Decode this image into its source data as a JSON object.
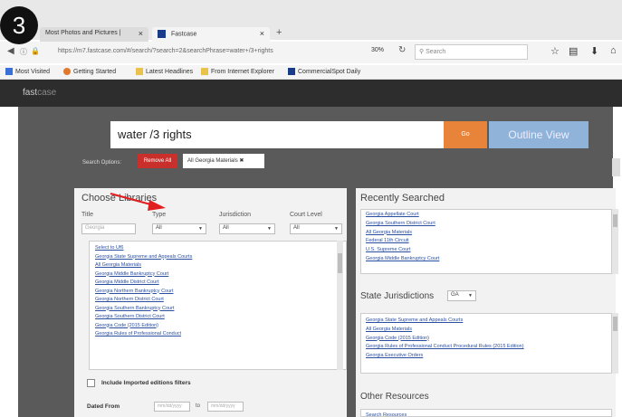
{
  "step": "3",
  "browser": {
    "tabs": [
      {
        "label": "Most Photos and Pictures |",
        "active": false
      },
      {
        "label": "Fastcase",
        "active": true
      }
    ],
    "url": "https://m7.fastcase.com/#/search/?search=2&searchPhrase=water+/3+rights",
    "zoom": "30%",
    "search_placeholder": "Search",
    "bookmarks": [
      "Most Visited",
      "Getting Started",
      "Latest Headlines",
      "From Internet Explorer",
      "CommercialSpot Daily"
    ]
  },
  "app": {
    "logo_main": "fast",
    "logo_sub": "case",
    "query": "water /3 rights",
    "go_label": "Go",
    "outline_label": "Outline View",
    "search_options_label": "Search Options:",
    "remove_all_label": "Remove All",
    "chip_label": "All Georgia Materials"
  },
  "choose_libraries": {
    "title": "Choose Libraries",
    "labels": {
      "title": "Title",
      "type": "Type",
      "jurisdiction": "Jurisdiction",
      "court_level": "Court Level"
    },
    "title_placeholder": "Georgia",
    "type_value": "All",
    "jurisdiction_value": "All",
    "court_level_value": "All",
    "courts": [
      "Select to Uf6",
      "Georgia State Supreme and Appeals Courts",
      "All Georgia Materials",
      "Georgia Middle Bankruptcy Court",
      "Georgia Middle District Court",
      "Georgia Northern Bankruptcy Court",
      "Georgia Northern District Court",
      "Georgia Southern Bankruptcy Court",
      "Georgia Southern District Court",
      "Georgia Code (2015 Edition)",
      "Georgia Rules of Professional Conduct"
    ],
    "include_label": "Include Imported editions filters",
    "dated_from_label": "Dated From",
    "to_label": "to",
    "date_from_placeholder": "mm/dd/yyyy",
    "date_to_placeholder": "mm/dd/yyyy"
  },
  "recently_searched": {
    "title": "Recently Searched",
    "items": [
      "Georgia Appellate Court",
      "Georgia Southern District Court",
      "All Georgia Materials",
      "Federal 11th Circuit",
      "U.S. Supreme Court",
      "Georgia Middle Bankruptcy Court"
    ]
  },
  "state_jurisdictions": {
    "title": "State Jurisdictions",
    "state_value": "GA",
    "items": [
      "Georgia State Supreme and Appeals Courts",
      "All Georgia Materials",
      "Georgia Code (2015 Edition)",
      "Georgia Rules of Professional Conduct Procedural Rules (2015 Edition)",
      "Georgia Executive Orders"
    ]
  },
  "other_resources": {
    "title": "Other Resources",
    "items": [
      "Search Resources"
    ]
  },
  "colors": {
    "go": "#e8843a",
    "outline": "#8fb3d9",
    "remove": "#c9302c",
    "arrow": "#e02020",
    "link": "#2a4fa0"
  }
}
